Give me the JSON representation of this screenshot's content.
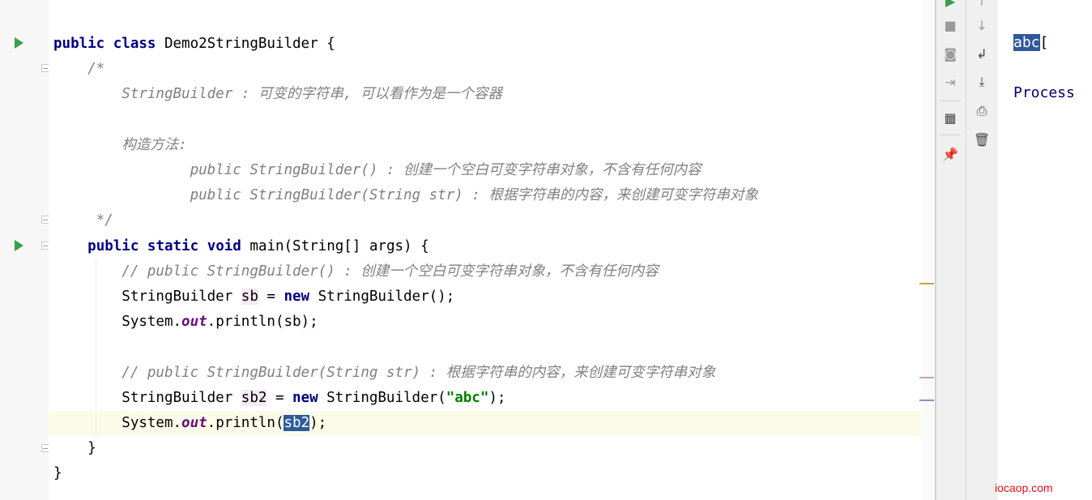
{
  "editor": {
    "lines": [
      {
        "id": "l1",
        "parts": [
          {
            "t": "public ",
            "c": "kw"
          },
          {
            "t": "class ",
            "c": "kw"
          },
          {
            "t": "Demo2StringBuilder {"
          }
        ]
      },
      {
        "id": "l2",
        "parts": [
          {
            "t": "    /*",
            "c": "cm"
          }
        ]
      },
      {
        "id": "l3",
        "parts": [
          {
            "t": "        StringBuilder : 可变的字符串, 可以看作为是一个容器",
            "c": "cm"
          }
        ]
      },
      {
        "id": "l4",
        "parts": []
      },
      {
        "id": "l5",
        "parts": [
          {
            "t": "        构造方法:",
            "c": "cm"
          }
        ]
      },
      {
        "id": "l6",
        "parts": [
          {
            "t": "                public StringBuilder() : 创建一个空白可变字符串对象，不含有任何内容",
            "c": "cm"
          }
        ]
      },
      {
        "id": "l7",
        "parts": [
          {
            "t": "                public StringBuilder(String str) : 根据字符串的内容，来创建可变字符串对象",
            "c": "cm"
          }
        ]
      },
      {
        "id": "l8",
        "parts": [
          {
            "t": "     */",
            "c": "cm"
          }
        ]
      },
      {
        "id": "l9",
        "parts": [
          {
            "t": "    "
          },
          {
            "t": "public ",
            "c": "kw"
          },
          {
            "t": "static ",
            "c": "kw"
          },
          {
            "t": "void ",
            "c": "kw"
          },
          {
            "t": "main(String[] args) {"
          }
        ]
      },
      {
        "id": "l10",
        "parts": [
          {
            "t": "        // public StringBuilder() : 创建一个空白可变字符串对象，不含有任何内容",
            "c": "cm"
          }
        ]
      },
      {
        "id": "l11",
        "parts": [
          {
            "t": "        StringBuilder "
          },
          {
            "t": "sb",
            "c": "hl"
          },
          {
            "t": " = "
          },
          {
            "t": "new ",
            "c": "kw"
          },
          {
            "t": "StringBuilder();"
          }
        ]
      },
      {
        "id": "l12",
        "parts": [
          {
            "t": "        System."
          },
          {
            "t": "out",
            "c": "fld"
          },
          {
            "t": ".println(sb);"
          }
        ]
      },
      {
        "id": "l13",
        "parts": []
      },
      {
        "id": "l14",
        "parts": [
          {
            "t": "        // public StringBuilder(String str) : 根据字符串的内容，来创建可变字符串对象",
            "c": "cm"
          }
        ]
      },
      {
        "id": "l15",
        "parts": [
          {
            "t": "        StringBuilder "
          },
          {
            "t": "sb2",
            "c": "hl"
          },
          {
            "t": " = "
          },
          {
            "t": "new ",
            "c": "kw"
          },
          {
            "t": "StringBuilder("
          },
          {
            "t": "\"abc\"",
            "c": "str"
          },
          {
            "t": ");"
          }
        ]
      },
      {
        "id": "l16",
        "parts": [
          {
            "t": "        System."
          },
          {
            "t": "out",
            "c": "fld"
          },
          {
            "t": ".println("
          },
          {
            "t": "sb2",
            "c": "sel"
          },
          {
            "t": ");"
          }
        ]
      },
      {
        "id": "l17",
        "parts": [
          {
            "t": "    }"
          }
        ]
      },
      {
        "id": "l18",
        "parts": [
          {
            "t": "}"
          }
        ]
      }
    ]
  },
  "console": {
    "output_line": "abc",
    "process_line": "Process"
  },
  "icons": {
    "run": "run-icon",
    "stop": "stop-icon",
    "camera": "camera-icon",
    "login": "login-icon",
    "layout": "layout-icon",
    "pin": "pin-icon",
    "arrow_down": "arrow-down-icon",
    "soft_wrap": "soft-wrap-icon",
    "scroll_end": "scroll-to-end-icon",
    "print": "print-icon",
    "trash": "trash-icon"
  },
  "colors": {
    "keyword": "#000080",
    "comment": "#808080",
    "string": "#008000",
    "run_green": "#3a9f49",
    "selection": "#2f5a9a"
  },
  "watermark": "iocaop.com"
}
